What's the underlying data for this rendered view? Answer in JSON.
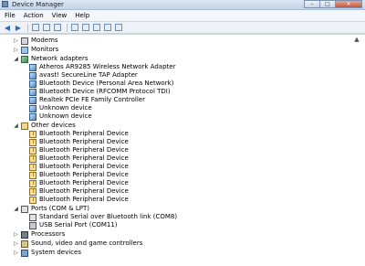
{
  "window": {
    "title": "Device Manager",
    "controls": [
      "–",
      "□",
      "✕"
    ]
  },
  "menu": [
    "File",
    "Action",
    "View",
    "Help"
  ],
  "toolbar": {
    "buttons": [
      "back-arrow-icon",
      "forward-arrow-icon",
      "show-hide-tree-icon",
      "properties-icon",
      "help-icon",
      "scan-hardware-icon",
      "update-driver-icon",
      "disable-icon",
      "uninstall-icon",
      "enable-icon"
    ]
  },
  "tree": {
    "scroll_glyph": "▲",
    "collapsed_glyph": "▷",
    "expanded_glyph": "◢",
    "modems": "Modems",
    "monitors": "Monitors",
    "network_adapters": {
      "label": "Network adapters",
      "children": [
        "Atheros AR9285 Wireless Network Adapter",
        "avast! SecureLine TAP Adapter",
        "Bluetooth Device (Personal Area Network)",
        "Bluetooth Device (RFCOMM Protocol TDI)",
        "Realtek PCIe FE Family Controller",
        "Unknown device",
        "Unknown device"
      ]
    },
    "other_devices": {
      "label": "Other devices",
      "children": [
        "Bluetooth Peripheral Device",
        "Bluetooth Peripheral Device",
        "Bluetooth Peripheral Device",
        "Bluetooth Peripheral Device",
        "Bluetooth Peripheral Device",
        "Bluetooth Peripheral Device",
        "Bluetooth Peripheral Device",
        "Bluetooth Peripheral Device",
        "Bluetooth Peripheral Device"
      ]
    },
    "ports": {
      "label": "Ports (COM & LPT)",
      "children": [
        "Standard Serial over Bluetooth link (COM8)",
        "USB Serial Port (COM11)"
      ]
    },
    "processors": "Processors",
    "sound": "Sound, video and game controllers",
    "system_devices": "System devices"
  }
}
